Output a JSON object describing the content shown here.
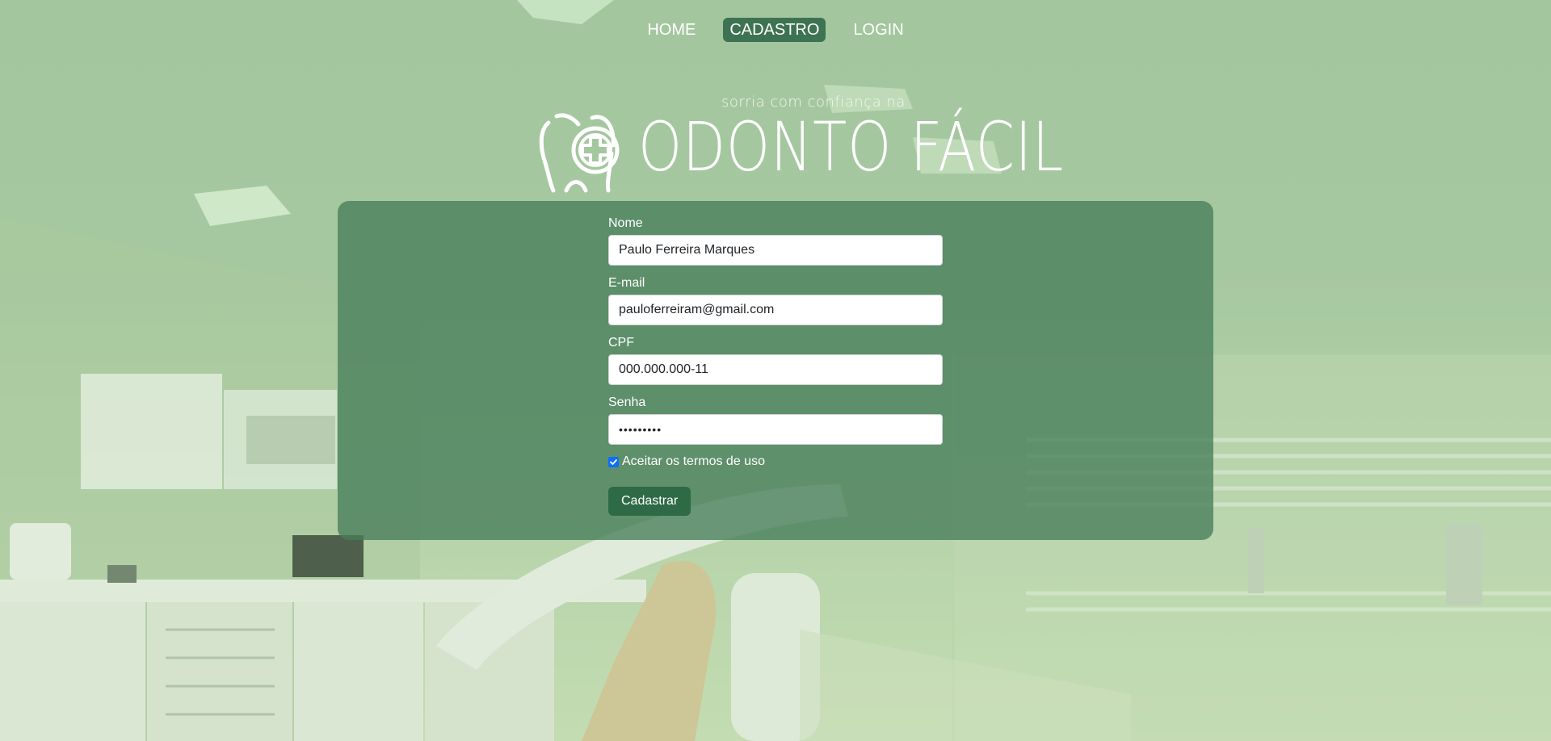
{
  "nav": {
    "items": [
      {
        "label": "HOME",
        "active": false
      },
      {
        "label": "CADASTRO",
        "active": true
      },
      {
        "label": "LOGIN",
        "active": false
      }
    ]
  },
  "logo": {
    "tagline": "sorria com confiança na",
    "wordmark": "ODONTO FÁCIL",
    "icon": "tooth-plus-icon"
  },
  "form": {
    "name_label": "Nome",
    "name_value": "Paulo Ferreira Marques",
    "email_label": "E-mail",
    "email_value": "pauloferreiram@gmail.com",
    "cpf_label": "CPF",
    "cpf_value": "000.000.000-11",
    "password_label": "Senha",
    "password_value": "•••••••••",
    "terms_label": "Aceitar os termos de uso",
    "terms_checked": true,
    "submit_label": "Cadastrar"
  },
  "colors": {
    "active_nav": "#3d7352",
    "panel": "#467d5a",
    "button": "#2f6a46",
    "checkbox": "#0d6efd"
  }
}
